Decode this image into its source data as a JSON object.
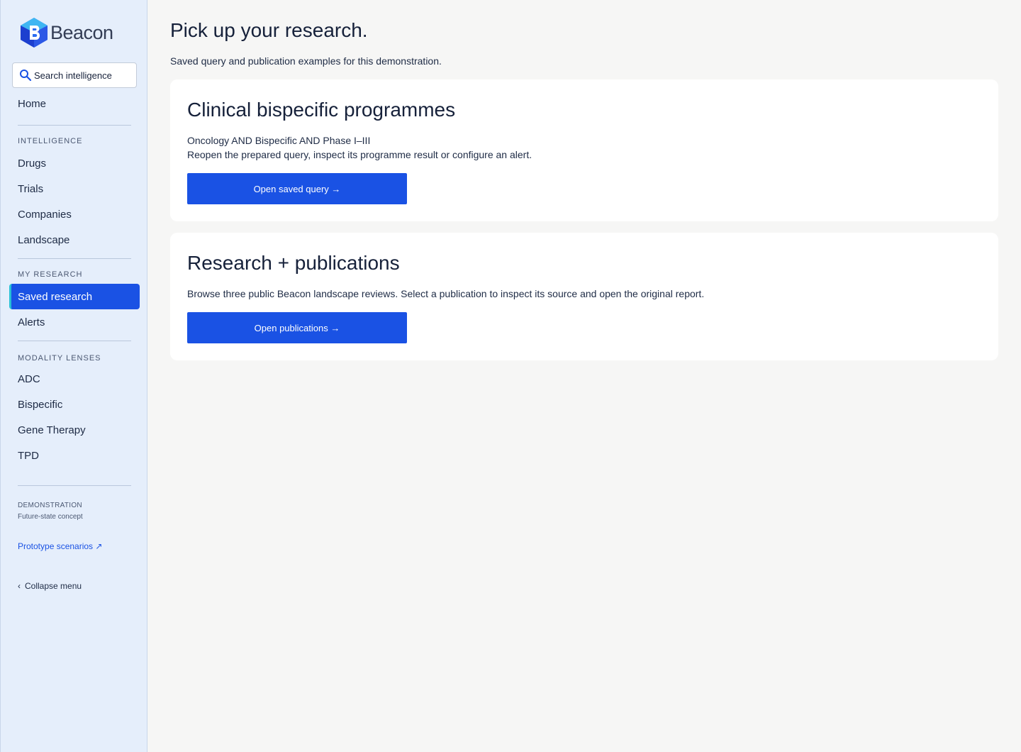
{
  "app": {
    "name": "Beacon"
  },
  "search": {
    "placeholder": "Search intelligence"
  },
  "nav": {
    "home": "Home",
    "intelligence_label": "INTELLIGENCE",
    "intelligence_items": [
      "Drugs",
      "Trials",
      "Companies",
      "Landscape"
    ],
    "research_label": "MY RESEARCH",
    "research_items": [
      "Saved research",
      "Alerts"
    ],
    "active_item": "Saved research",
    "modality_label": "MODALITY LENSES",
    "modality_items": [
      "ADC",
      "Bispecific",
      "Gene Therapy",
      "TPD"
    ]
  },
  "demo": {
    "label": "DEMONSTRATION",
    "sub": "Future-state concept",
    "link": "Prototype scenarios ↗",
    "collapse": "Collapse menu"
  },
  "page": {
    "title": "Pick up your research.",
    "subtitle": "Saved query and publication examples for this demonstration."
  },
  "cards": [
    {
      "title": "Clinical bispecific programmes",
      "query": "Oncology AND Bispecific AND Phase I–III",
      "description": "Reopen the prepared query, inspect its programme result or configure an alert.",
      "button": "Open saved query →"
    },
    {
      "title": "Research + publications",
      "description": "Browse three public Beacon landscape reviews. Select a publication to inspect its source and open the original report.",
      "button": "Open publications →"
    }
  ],
  "colors": {
    "accent": "#1a52e4",
    "sidebar_bg": "#e5eefb",
    "page_bg": "#f6f6f5",
    "active_marker": "#27c1d6"
  }
}
